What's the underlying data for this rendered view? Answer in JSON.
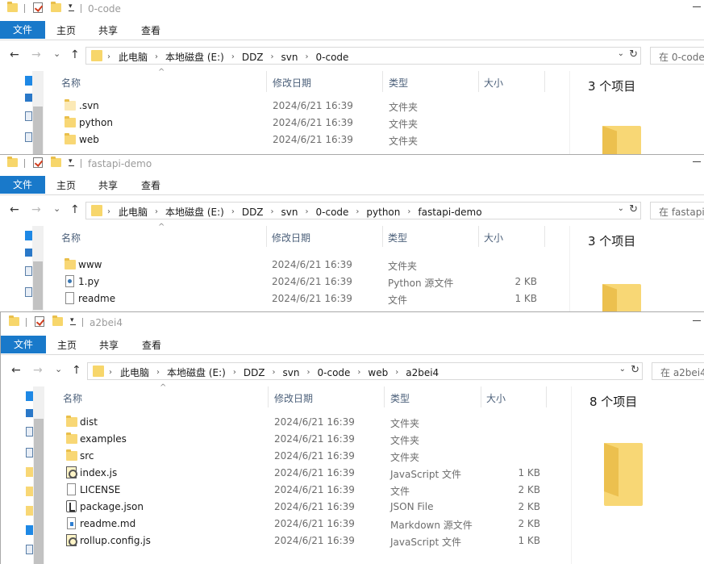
{
  "common": {
    "ribbon_tabs": [
      "文件",
      "主页",
      "共享",
      "查看"
    ],
    "columns": {
      "name": "名称",
      "date": "修改日期",
      "type": "类型",
      "size": "大小"
    },
    "icons": [
      "folder-icon",
      "checkmark-icon",
      "back-arrow-icon",
      "forward-arrow-icon",
      "up-arrow-icon",
      "refresh-icon",
      "python-file-icon",
      "javascript-file-icon",
      "json-file-icon",
      "markdown-file-icon",
      "text-file-icon"
    ],
    "nav": {
      "back": "←",
      "forward": "→",
      "recent": "⌄",
      "up": "↑",
      "dropdown": "⌄",
      "refresh": "↻"
    }
  },
  "windows": [
    {
      "title": "0-code",
      "breadcrumb": [
        "此电脑",
        "本地磁盘 (E:)",
        "DDZ",
        "svn",
        "0-code"
      ],
      "search_placeholder": "在 0-code",
      "item_count": "3 个项目",
      "files": [
        {
          "name": ".svn",
          "date": "2024/6/21 16:39",
          "type": "文件夹",
          "size": "",
          "icon": "folder-hidden"
        },
        {
          "name": "python",
          "date": "2024/6/21 16:39",
          "type": "文件夹",
          "size": "",
          "icon": "folder"
        },
        {
          "name": "web",
          "date": "2024/6/21 16:39",
          "type": "文件夹",
          "size": "",
          "icon": "folder"
        }
      ]
    },
    {
      "title": "fastapi-demo",
      "breadcrumb": [
        "此电脑",
        "本地磁盘 (E:)",
        "DDZ",
        "svn",
        "0-code",
        "python",
        "fastapi-demo"
      ],
      "search_placeholder": "在 fastapi-",
      "item_count": "3 个项目",
      "files": [
        {
          "name": "www",
          "date": "2024/6/21 16:39",
          "type": "文件夹",
          "size": "",
          "icon": "folder"
        },
        {
          "name": "1.py",
          "date": "2024/6/21 16:39",
          "type": "Python 源文件",
          "size": "2 KB",
          "icon": "python"
        },
        {
          "name": "readme",
          "date": "2024/6/21 16:39",
          "type": "文件",
          "size": "1 KB",
          "icon": "file"
        }
      ]
    },
    {
      "title": "a2bei4",
      "breadcrumb": [
        "此电脑",
        "本地磁盘 (E:)",
        "DDZ",
        "svn",
        "0-code",
        "web",
        "a2bei4"
      ],
      "search_placeholder": "在 a2bei4",
      "item_count": "8 个项目",
      "files": [
        {
          "name": "dist",
          "date": "2024/6/21 16:39",
          "type": "文件夹",
          "size": "",
          "icon": "folder"
        },
        {
          "name": "examples",
          "date": "2024/6/21 16:39",
          "type": "文件夹",
          "size": "",
          "icon": "folder"
        },
        {
          "name": "src",
          "date": "2024/6/21 16:39",
          "type": "文件夹",
          "size": "",
          "icon": "folder"
        },
        {
          "name": "index.js",
          "date": "2024/6/21 16:39",
          "type": "JavaScript 文件",
          "size": "1 KB",
          "icon": "js"
        },
        {
          "name": "LICENSE",
          "date": "2024/6/21 16:39",
          "type": "文件",
          "size": "2 KB",
          "icon": "file"
        },
        {
          "name": "package.json",
          "date": "2024/6/21 16:39",
          "type": "JSON File",
          "size": "2 KB",
          "icon": "json"
        },
        {
          "name": "readme.md",
          "date": "2024/6/21 16:39",
          "type": "Markdown 源文件",
          "size": "2 KB",
          "icon": "md"
        },
        {
          "name": "rollup.config.js",
          "date": "2024/6/21 16:39",
          "type": "JavaScript 文件",
          "size": "1 KB",
          "icon": "js"
        }
      ]
    }
  ]
}
